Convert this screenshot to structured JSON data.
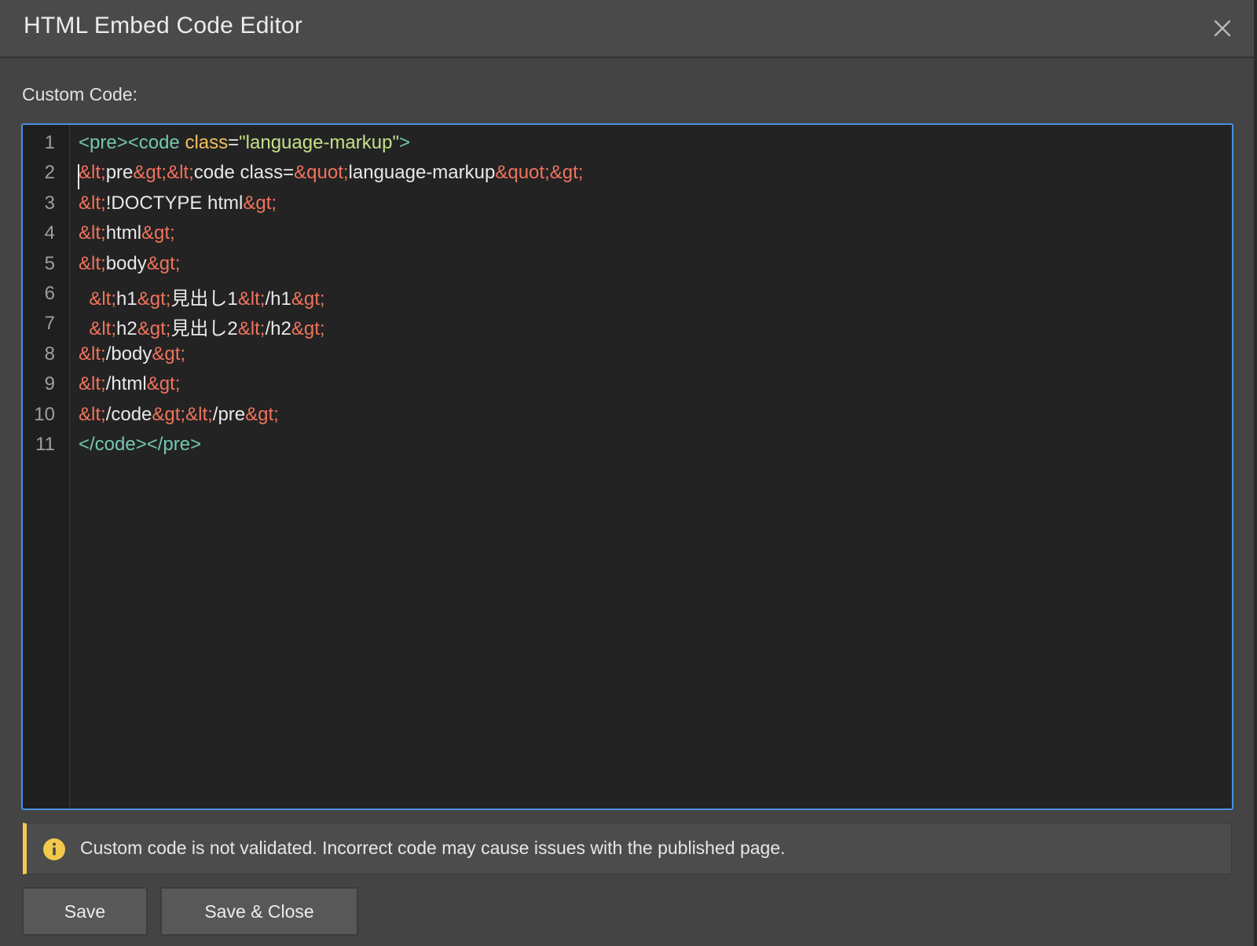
{
  "dialog": {
    "title": "HTML Embed Code Editor",
    "close_icon": "close-icon"
  },
  "editor": {
    "label": "Custom Code:",
    "lines": [
      {
        "num": "1",
        "tokens": [
          {
            "t": "<pre><code ",
            "c": "tag"
          },
          {
            "t": "class",
            "c": "attr"
          },
          {
            "t": "=",
            "c": "eq"
          },
          {
            "t": "\"language-markup\"",
            "c": "str"
          },
          {
            "t": ">",
            "c": "tag"
          }
        ]
      },
      {
        "num": "2",
        "tokens": [
          {
            "t": "&lt;",
            "c": "ent"
          },
          {
            "t": "pre",
            "c": "text"
          },
          {
            "t": "&gt;&lt;",
            "c": "ent"
          },
          {
            "t": "code class=",
            "c": "text"
          },
          {
            "t": "&quot;",
            "c": "ent"
          },
          {
            "t": "language-markup",
            "c": "text"
          },
          {
            "t": "&quot;&gt;",
            "c": "ent"
          }
        ]
      },
      {
        "num": "3",
        "tokens": [
          {
            "t": "&lt;",
            "c": "ent"
          },
          {
            "t": "!DOCTYPE html",
            "c": "text"
          },
          {
            "t": "&gt;",
            "c": "ent"
          }
        ]
      },
      {
        "num": "4",
        "tokens": [
          {
            "t": "&lt;",
            "c": "ent"
          },
          {
            "t": "html",
            "c": "text"
          },
          {
            "t": "&gt;",
            "c": "ent"
          }
        ]
      },
      {
        "num": "5",
        "tokens": [
          {
            "t": "&lt;",
            "c": "ent"
          },
          {
            "t": "body",
            "c": "text"
          },
          {
            "t": "&gt;",
            "c": "ent"
          }
        ]
      },
      {
        "num": "6",
        "tokens": [
          {
            "t": "  ",
            "c": "text"
          },
          {
            "t": "&lt;",
            "c": "ent"
          },
          {
            "t": "h1",
            "c": "text"
          },
          {
            "t": "&gt;",
            "c": "ent"
          },
          {
            "t": "見出し1",
            "c": "text"
          },
          {
            "t": "&lt;",
            "c": "ent"
          },
          {
            "t": "/h1",
            "c": "text"
          },
          {
            "t": "&gt;",
            "c": "ent"
          }
        ]
      },
      {
        "num": "7",
        "tokens": [
          {
            "t": "  ",
            "c": "text"
          },
          {
            "t": "&lt;",
            "c": "ent"
          },
          {
            "t": "h2",
            "c": "text"
          },
          {
            "t": "&gt;",
            "c": "ent"
          },
          {
            "t": "見出し2",
            "c": "text"
          },
          {
            "t": "&lt;",
            "c": "ent"
          },
          {
            "t": "/h2",
            "c": "text"
          },
          {
            "t": "&gt;",
            "c": "ent"
          }
        ]
      },
      {
        "num": "8",
        "tokens": [
          {
            "t": "&lt;",
            "c": "ent"
          },
          {
            "t": "/body",
            "c": "text"
          },
          {
            "t": "&gt;",
            "c": "ent"
          }
        ]
      },
      {
        "num": "9",
        "tokens": [
          {
            "t": "&lt;",
            "c": "ent"
          },
          {
            "t": "/html",
            "c": "text"
          },
          {
            "t": "&gt;",
            "c": "ent"
          }
        ]
      },
      {
        "num": "10",
        "tokens": [
          {
            "t": "&lt;",
            "c": "ent"
          },
          {
            "t": "/code",
            "c": "text"
          },
          {
            "t": "&gt;&lt;",
            "c": "ent"
          },
          {
            "t": "/pre",
            "c": "text"
          },
          {
            "t": "&gt;",
            "c": "ent"
          }
        ]
      },
      {
        "num": "11",
        "tokens": [
          {
            "t": "</code></pre>",
            "c": "tag"
          }
        ]
      }
    ]
  },
  "notice": {
    "icon": "info-icon",
    "text": "Custom code is not validated. Incorrect code may cause issues with the published page.",
    "accent_color": "#f2c94c"
  },
  "buttons": {
    "save": "Save",
    "save_close": "Save & Close"
  },
  "colors": {
    "editor_border": "#4a90e2",
    "tag": "#73c7b0",
    "attr": "#f0c060",
    "string": "#c5e08a",
    "entity": "#f0735c"
  }
}
